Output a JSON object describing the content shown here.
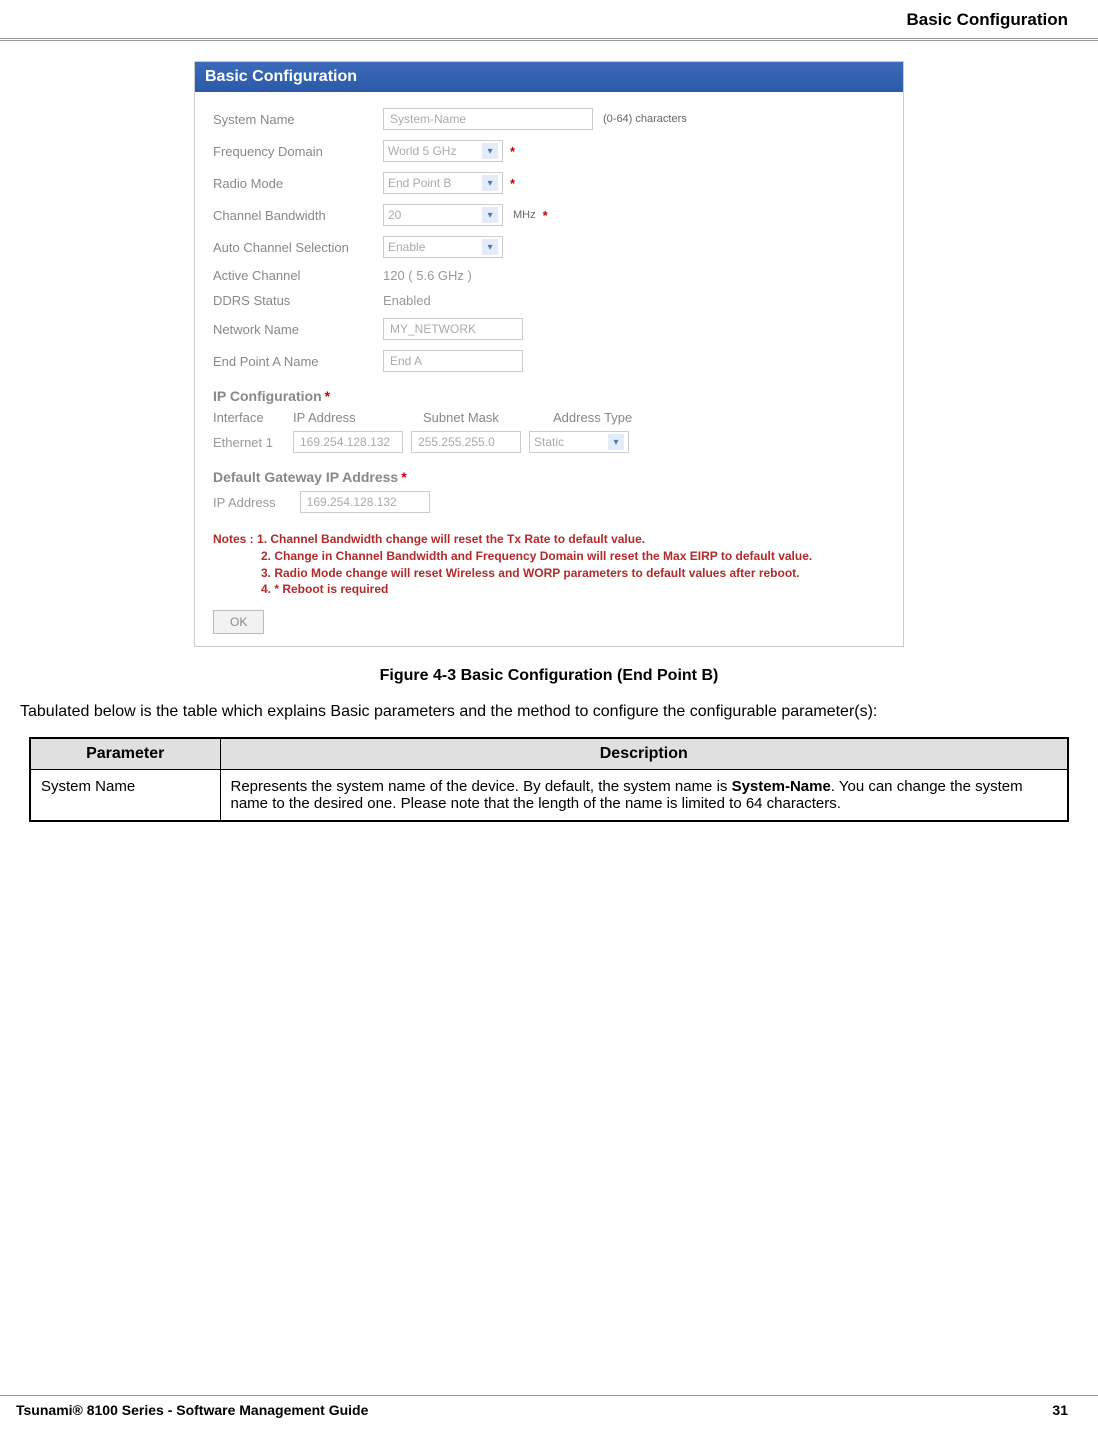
{
  "header": {
    "title": "Basic Configuration"
  },
  "panel": {
    "title": "Basic Configuration",
    "rows": {
      "system_name": {
        "label": "System Name",
        "value": "System-Name",
        "hint": "(0-64) characters"
      },
      "freq_domain": {
        "label": "Frequency Domain",
        "value": "World 5 GHz"
      },
      "radio_mode": {
        "label": "Radio Mode",
        "value": "End Point B"
      },
      "channel_bw": {
        "label": "Channel Bandwidth",
        "value": "20",
        "unit": "MHz"
      },
      "auto_channel": {
        "label": "Auto Channel Selection",
        "value": "Enable"
      },
      "active_channel": {
        "label": "Active Channel",
        "value": "120  ( 5.6 GHz )"
      },
      "ddrs": {
        "label": "DDRS Status",
        "value": "Enabled"
      },
      "network_name": {
        "label": "Network Name",
        "value": "MY_NETWORK"
      },
      "endpoint_a": {
        "label": "End Point A Name",
        "value": "End A"
      }
    },
    "ip_config": {
      "title": "IP Configuration",
      "headers": {
        "iface": "Interface",
        "ip": "IP Address",
        "mask": "Subnet Mask",
        "type": "Address Type"
      },
      "row": {
        "iface": "Ethernet 1",
        "ip": "169.254.128.132",
        "mask": "255.255.255.0",
        "type": "Static"
      }
    },
    "gateway": {
      "title": "Default Gateway IP Address",
      "label": "IP Address",
      "value": "169.254.128.132"
    },
    "notes": {
      "prefix": "Notes :",
      "n1": "1. Channel Bandwidth change will reset the Tx Rate to default value.",
      "n2": "2. Change in Channel Bandwidth and Frequency Domain will reset the Max EIRP to default value.",
      "n3": "3. Radio Mode change will reset Wireless and WORP parameters to default values after reboot.",
      "n4": "4. * Reboot is required"
    },
    "ok_label": "OK"
  },
  "figure_caption": "Figure 4-3 Basic Configuration (End Point B)",
  "desc_text": "Tabulated below is the table which explains Basic parameters and the method to configure the configurable parameter(s):",
  "table": {
    "h1": "Parameter",
    "h2": "Description",
    "r1c1": "System Name",
    "r1c2_a": "Represents the system name of the device. By default, the system name is ",
    "r1c2_bold": "System-Name",
    "r1c2_b": ". You can change the system name to the desired one. Please note that the length of the name is limited to 64 characters."
  },
  "footer": {
    "left": "Tsunami® 8100 Series - Software Management Guide",
    "right": "31"
  }
}
